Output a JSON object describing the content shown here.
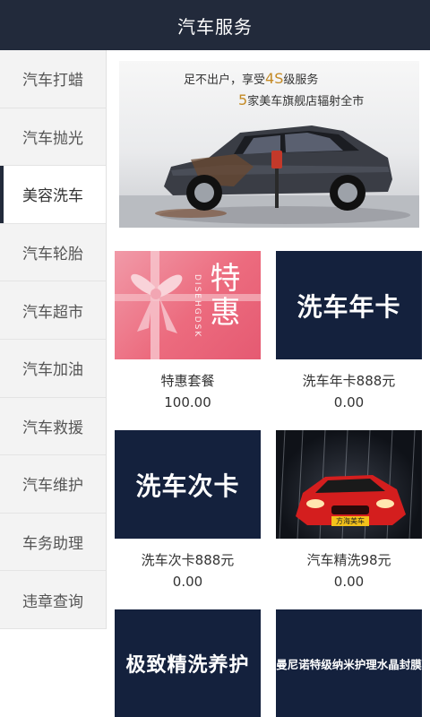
{
  "header": {
    "title": "汽车服务"
  },
  "sidebar": {
    "items": [
      {
        "label": "汽车打蜡",
        "active": false
      },
      {
        "label": "汽车抛光",
        "active": false
      },
      {
        "label": "美容洗车",
        "active": true
      },
      {
        "label": "汽车轮胎",
        "active": false
      },
      {
        "label": "汽车超市",
        "active": false
      },
      {
        "label": "汽车加油",
        "active": false
      },
      {
        "label": "汽车救援",
        "active": false
      },
      {
        "label": "汽车维护",
        "active": false
      },
      {
        "label": "车务助理",
        "active": false
      },
      {
        "label": "违章查询",
        "active": false
      }
    ]
  },
  "banner": {
    "line1_pre": "足不出户，享受",
    "line1_hl": "4S",
    "line1_post": "级服务",
    "line2_hl": "5",
    "line2_post": "家美车旗舰店辐射全市"
  },
  "products": [
    {
      "image_text": "特惠",
      "image_subtext": "DISEHGDSK",
      "title": "特惠套餐",
      "price": "100.00"
    },
    {
      "image_text": "洗车年卡",
      "title": "洗车年卡888元",
      "price": "0.00"
    },
    {
      "image_text": "洗车次卡",
      "title": "洗车次卡888元",
      "price": "0.00"
    },
    {
      "image_text": "方海美车",
      "title": "汽车精洗98元",
      "price": "0.00"
    },
    {
      "image_text": "极致精洗养护"
    },
    {
      "image_text": "曼尼诺特级纳米护理水晶封膜"
    }
  ],
  "colors": {
    "header_bg": "#222a3b",
    "card_navy": "#14213d",
    "accent_gold": "#c48a25"
  }
}
